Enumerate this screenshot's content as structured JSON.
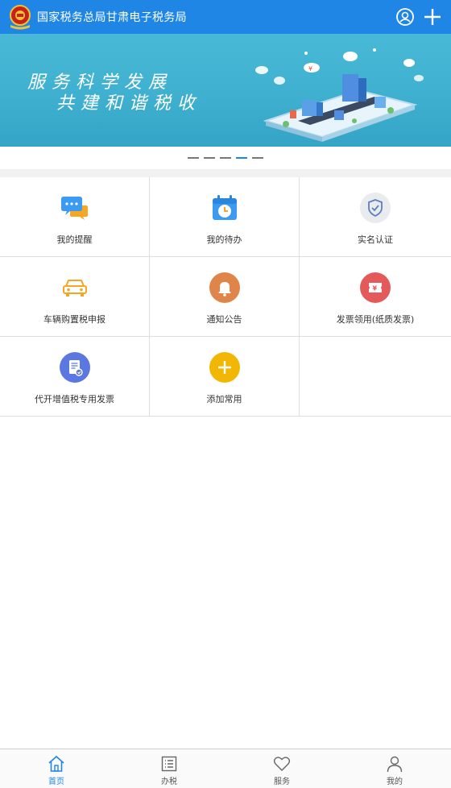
{
  "header": {
    "title": "国家税务总局甘肃电子税务局",
    "logo_icon": "tax-emblem-icon",
    "actions": [
      {
        "icon": "user-icon"
      },
      {
        "icon": "plus-icon"
      }
    ]
  },
  "banner": {
    "line1": "服务科学发展",
    "line2": "共建和谐税收",
    "slides": 5,
    "active_slide": 4
  },
  "grid": {
    "items": [
      {
        "label": "我的提醒",
        "icon": "chat-bubble-icon"
      },
      {
        "label": "我的待办",
        "icon": "calendar-clock-icon"
      },
      {
        "label": "实名认证",
        "icon": "shield-check-icon"
      },
      {
        "label": "车辆购置税申报",
        "icon": "car-icon"
      },
      {
        "label": "通知公告",
        "icon": "bell-icon"
      },
      {
        "label": "发票领用(纸质发票)",
        "icon": "invoice-ticket-icon"
      },
      {
        "label": "代开增值税专用发票",
        "icon": "document-edit-icon"
      },
      {
        "label": "添加常用",
        "icon": "add-circle-icon"
      }
    ]
  },
  "tabbar": {
    "tabs": [
      {
        "label": "首页",
        "icon": "home-icon",
        "active": true
      },
      {
        "label": "办税",
        "icon": "list-icon",
        "active": false
      },
      {
        "label": "服务",
        "icon": "heart-icon",
        "active": false
      },
      {
        "label": "我的",
        "icon": "person-icon",
        "active": false
      }
    ]
  },
  "colors": {
    "accent": "#1f86e6",
    "banner": "#3fb0cf"
  }
}
